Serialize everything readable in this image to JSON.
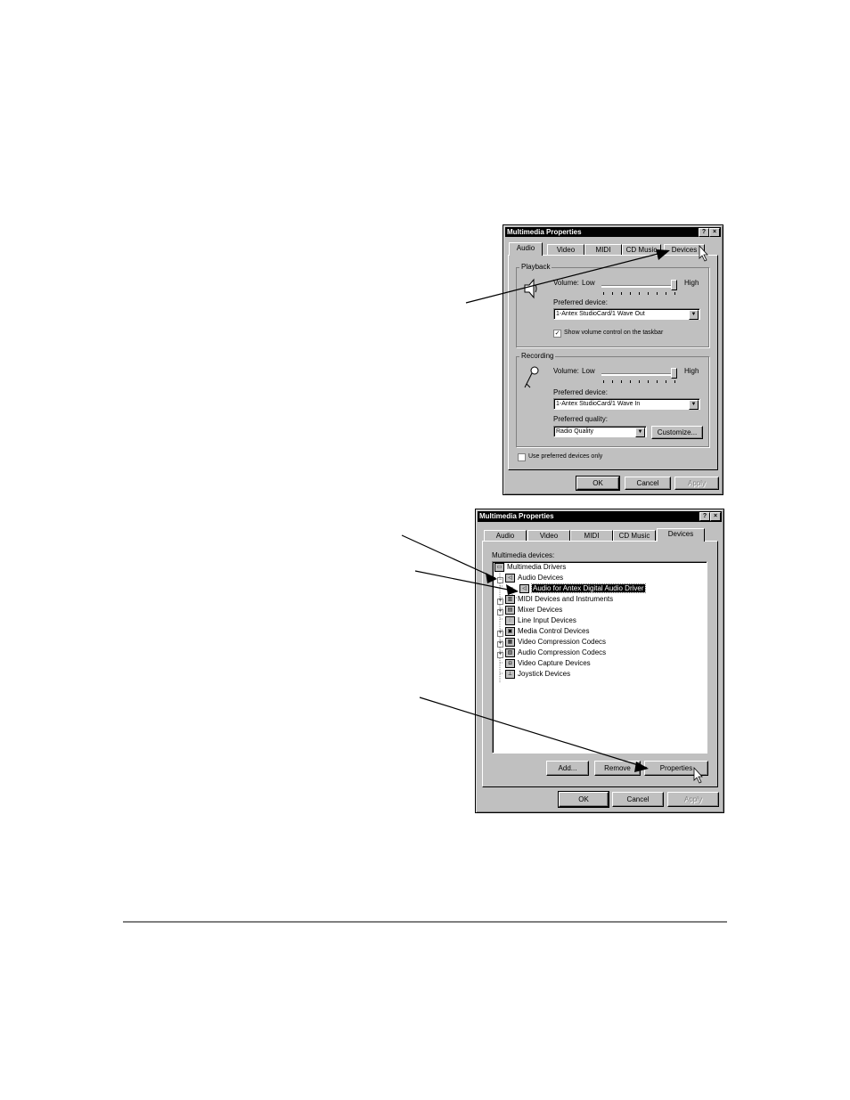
{
  "dialog1": {
    "title": "Multimedia Properties",
    "help_btn": "?",
    "close_btn": "×",
    "tabs": [
      "Audio",
      "Video",
      "MIDI",
      "CD Music",
      "Devices"
    ],
    "active_tab": "Audio",
    "playback": {
      "group_label": "Playback",
      "volume_label": "Volume:",
      "low": "Low",
      "high": "High",
      "volume_level": 1.0,
      "preferred_label": "Preferred device:",
      "preferred_value": "1-Antex StudioCard/1 Wave Out",
      "show_volume_label": "Show volume control on the taskbar",
      "show_volume_checked": true
    },
    "recording": {
      "group_label": "Recording",
      "volume_label": "Volume:",
      "low": "Low",
      "high": "High",
      "volume_level": 1.0,
      "preferred_label": "Preferred device:",
      "preferred_value": "1-Antex StudioCard/1 Wave In",
      "quality_label": "Preferred quality:",
      "quality_value": "Radio Quality",
      "customize_label": "Customize..."
    },
    "use_preferred_label": "Use preferred devices only",
    "use_preferred_checked": false,
    "ok": "OK",
    "cancel": "Cancel",
    "apply": "Apply"
  },
  "dialog2": {
    "title": "Multimedia Properties",
    "help_btn": "?",
    "close_btn": "×",
    "tabs": [
      "Audio",
      "Video",
      "MIDI",
      "CD Music",
      "Devices"
    ],
    "active_tab": "Devices",
    "devices_label": "Multimedia devices:",
    "tree": [
      {
        "label": "Multimedia Drivers",
        "icon": "computer-icon"
      },
      {
        "label": "Audio Devices",
        "icon": "speaker-icon"
      },
      {
        "label": "Audio for Antex Digital Audio Driver",
        "icon": "speaker-icon",
        "selected": true
      },
      {
        "label": "MIDI Devices and Instruments",
        "icon": "midi-icon"
      },
      {
        "label": "Mixer Devices",
        "icon": "mixer-icon"
      },
      {
        "label": "Line Input Devices",
        "icon": "line-input-icon"
      },
      {
        "label": "Media Control Devices",
        "icon": "media-control-icon"
      },
      {
        "label": "Video Compression Codecs",
        "icon": "video-codec-icon"
      },
      {
        "label": "Audio Compression Codecs",
        "icon": "audio-codec-icon"
      },
      {
        "label": "Video Capture Devices",
        "icon": "camera-icon"
      },
      {
        "label": "Joystick Devices",
        "icon": "joystick-icon"
      }
    ],
    "add": "Add...",
    "remove": "Remove",
    "properties": "Properties",
    "ok": "OK",
    "cancel": "Cancel",
    "apply": "Apply"
  }
}
